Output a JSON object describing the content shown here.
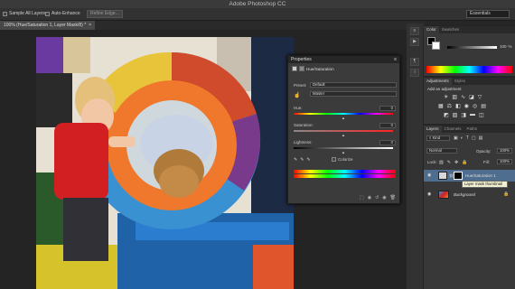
{
  "app": {
    "title": "Adobe Photoshop CC"
  },
  "options_bar": {
    "sample_all_layers": "Sample All Layers",
    "auto_enhance": "Auto-Enhance",
    "refine_edge": "Refine Edge...",
    "workspace": "Essentials"
  },
  "document_tab": {
    "label": "100% (Hue/Saturation 1, Layer Mask/8) *"
  },
  "properties_panel": {
    "title": "Properties",
    "subtitle": "Hue/Saturation",
    "preset_label": "Preset:",
    "preset_value": "Default",
    "channel_value": "Master",
    "hue_label": "Hue:",
    "hue_value": "0",
    "saturation_label": "Saturation:",
    "saturation_value": "0",
    "lightness_label": "Lightness:",
    "lightness_value": "0",
    "colorize_label": "Colorize"
  },
  "color_panel": {
    "tabs": [
      "Color",
      "Swatches"
    ],
    "value": "100",
    "unit": "%"
  },
  "adjustments_panel": {
    "tabs": [
      "Adjustments",
      "Styles"
    ],
    "heading": "Add an adjustment"
  },
  "layers_panel": {
    "tabs": [
      "Layers",
      "Channels",
      "Paths"
    ],
    "kind": "Kind",
    "blend_mode": "Normal",
    "opacity_label": "Opacity:",
    "opacity_value": "100%",
    "lock_label": "Lock:",
    "fill_label": "Fill:",
    "fill_value": "100%",
    "layers": [
      {
        "name": "Hue/Saturation 1"
      },
      {
        "name": "Background"
      }
    ],
    "tooltip": "Layer mask thumbnail"
  }
}
